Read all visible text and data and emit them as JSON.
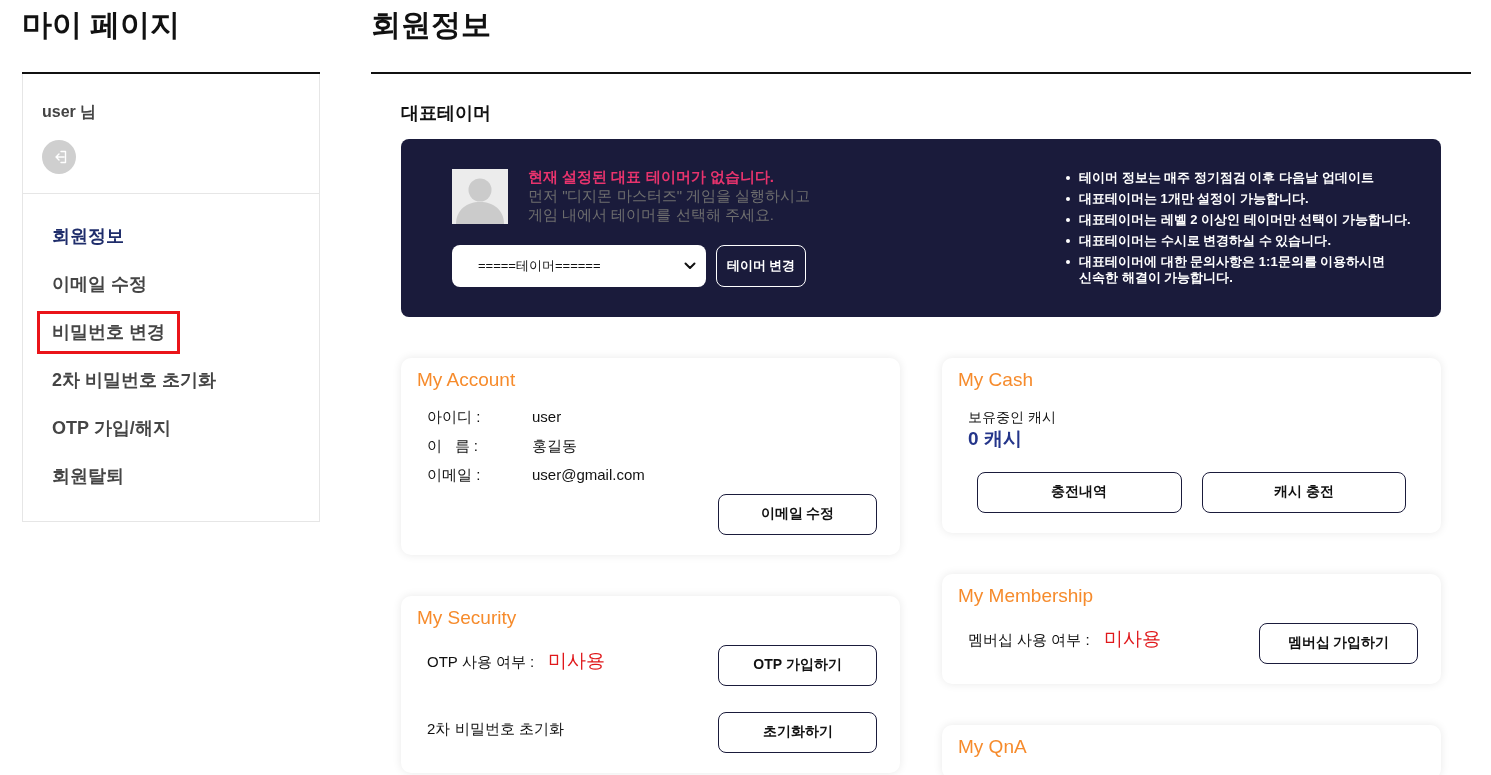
{
  "sidebar": {
    "title": "마이 페이지",
    "user_name": "user 님",
    "menu": [
      {
        "label": "회원정보",
        "selected": true,
        "highlighted": false
      },
      {
        "label": "이메일 수정",
        "selected": false,
        "highlighted": false
      },
      {
        "label": "비밀번호 변경",
        "selected": false,
        "highlighted": true
      },
      {
        "label": "2차 비밀번호 초기화",
        "selected": false,
        "highlighted": false
      },
      {
        "label": "OTP 가입/해지",
        "selected": false,
        "highlighted": false
      },
      {
        "label": "회원탈퇴",
        "selected": false,
        "highlighted": false
      }
    ]
  },
  "main": {
    "title": "회원정보"
  },
  "representative_tamer": {
    "heading": "대표테이머",
    "notice": {
      "title": "현재 설정된 대표 테이머가 없습니다.",
      "text": "먼저 \"디지몬 마스터즈\" 게임을 실행하시고\n게임 내에서 테이머를 선택해 주세요."
    },
    "select": {
      "value": "=====테이머======"
    },
    "change_button": "테이머 변경",
    "info": [
      "테이머 정보는 매주 정기점검 이후 다음날 업데이트",
      "대표테이머는 1개만 설정이 가능합니다.",
      "대표테이머는 레벨 2 이상인 테이머만 선택이 가능합니다.",
      "대표테이머는 수시로 변경하실 수 있습니다.",
      "대표테이머에 대한 문의사항은 1:1문의를 이용하시면 신속한 해결이 가능합니다."
    ]
  },
  "card_columns": [
    {
      "cards": [
        {
          "kind": "fields",
          "title": "My Account",
          "fields": [
            {
              "label": "아이디 :",
              "value": "user"
            },
            {
              "label": "이   름 :",
              "value": "홍길동"
            },
            {
              "label": "이메일 :",
              "value": "user@gmail.com"
            }
          ],
          "button": "이메일 수정"
        },
        {
          "kind": "status",
          "title": "My Security",
          "rows": [
            {
              "label": "OTP 사용 여부 :",
              "status": "미사용",
              "button": "OTP 가입하기"
            },
            {
              "label": "2차 비밀번호 초기화",
              "button": "초기화하기"
            }
          ]
        }
      ]
    },
    {
      "cards": [
        {
          "kind": "balance",
          "title": "My Cash",
          "label": "보유중인 캐시",
          "amount": "0 캐시",
          "buttons": [
            "충전내역",
            "캐시 충전"
          ]
        },
        {
          "kind": "status",
          "title": "My Membership",
          "rows": [
            {
              "label": "멤버십 사용 여부 :",
              "status": "미사용",
              "button": "멤버십 가입하기"
            }
          ]
        },
        {
          "kind": "title_only",
          "title": "My QnA"
        }
      ]
    }
  ]
}
